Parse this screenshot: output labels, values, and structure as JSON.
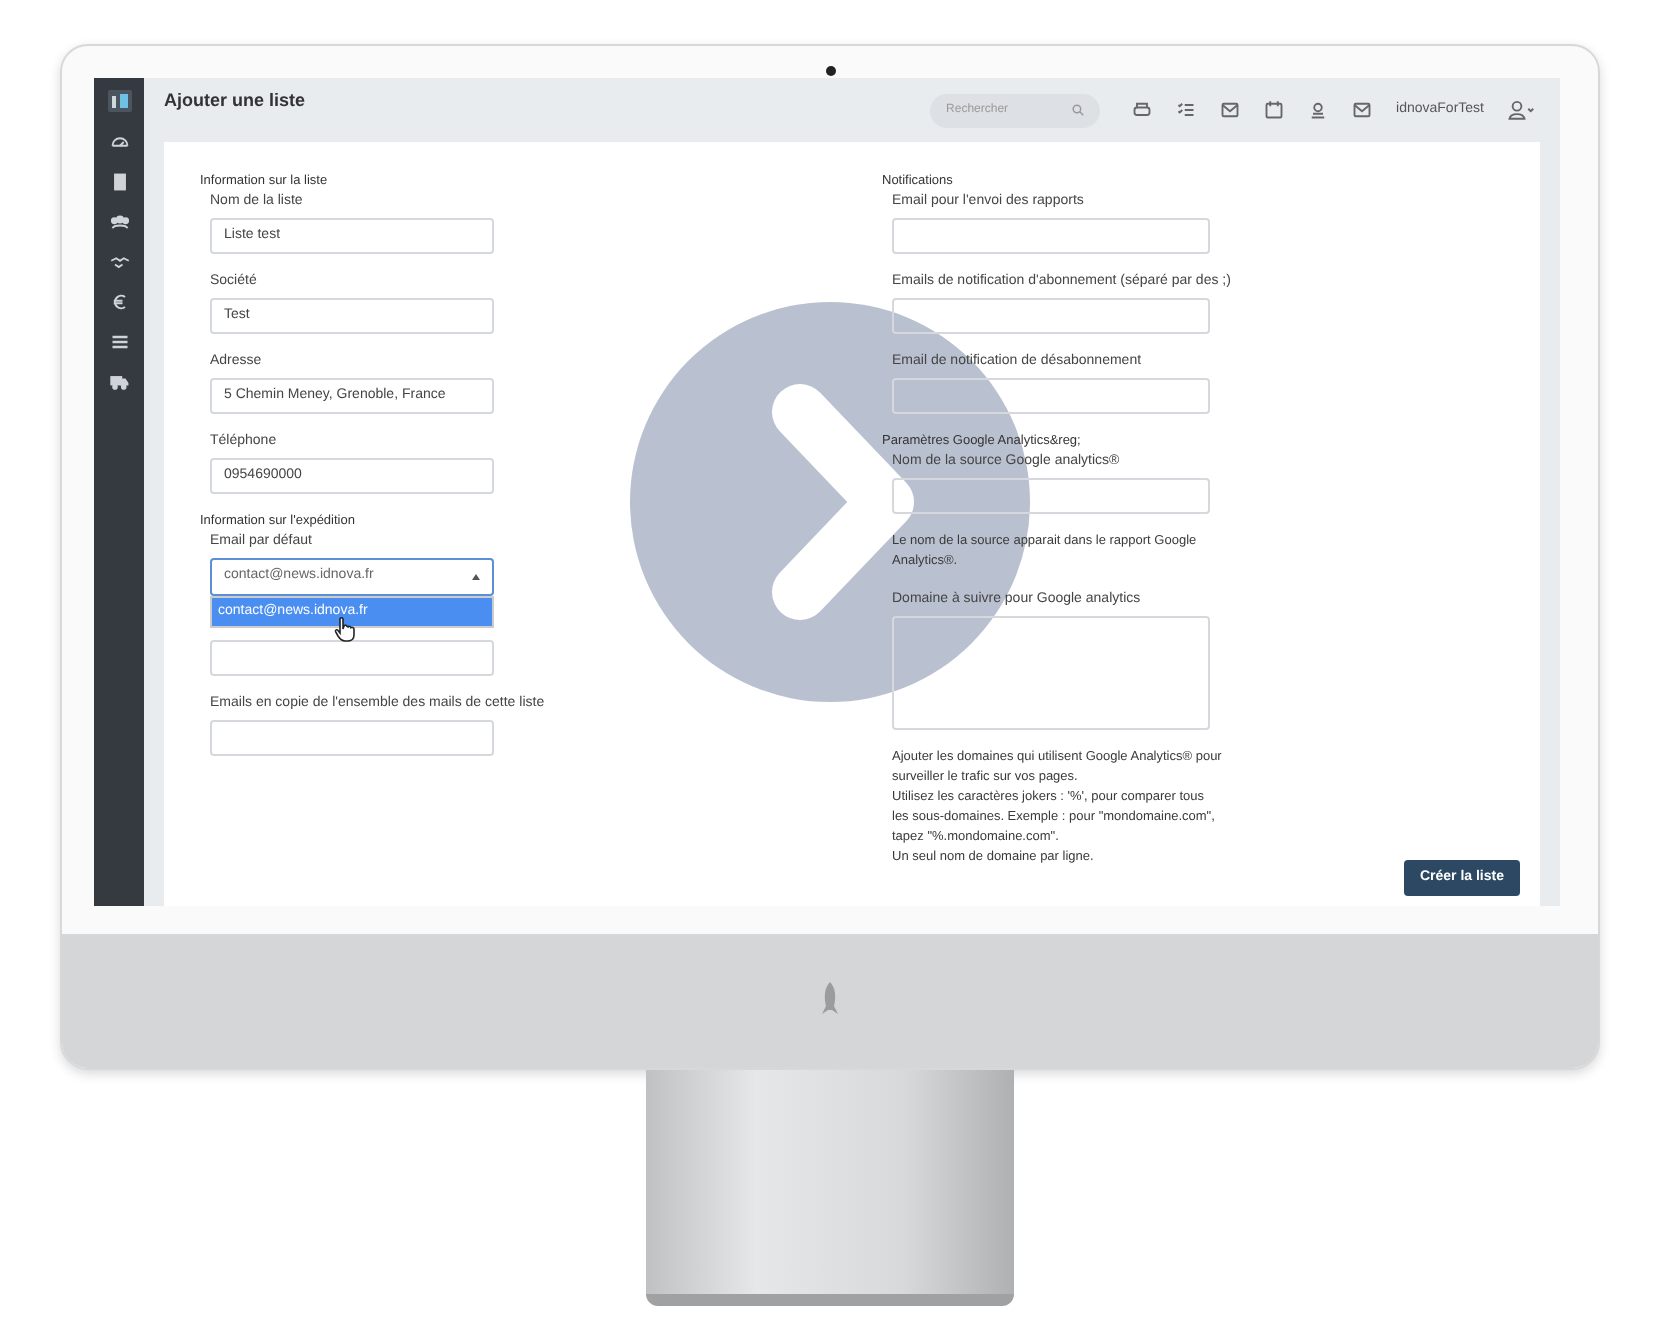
{
  "topbar": {
    "title": "Ajouter une liste",
    "search": {
      "placeholder": "Rechercher"
    },
    "username": "idnovaForTest"
  },
  "columns": [
    {
      "sections": [
        {
          "title": "Information sur la liste",
          "fields": [
            {
              "kind": "input",
              "label": "Nom de la liste",
              "value": "Liste test"
            },
            {
              "kind": "input",
              "label": "Société",
              "value": "Test"
            },
            {
              "kind": "input",
              "label": "Adresse",
              "value": "5 Chemin Meney, Grenoble, France"
            },
            {
              "kind": "input",
              "label": "Téléphone",
              "value": "0954690000"
            }
          ]
        },
        {
          "title": "Information sur l'expédition",
          "fields": [
            {
              "kind": "select",
              "label": "Email par défaut",
              "value": "contact@news.idnova.fr",
              "open": true,
              "options": [
                {
                  "label": "contact@news.idnova.fr",
                  "selected": true
                }
              ]
            },
            {
              "kind": "input"
            },
            {
              "kind": "input",
              "label": "Emails en copie de l'ensemble des mails de cette liste"
            }
          ]
        }
      ]
    },
    {
      "sections": [
        {
          "title": "Notifications",
          "fields": [
            {
              "kind": "input",
              "label": "Email pour l'envoi des rapports"
            },
            {
              "kind": "input",
              "label": "Emails de notification d'abonnement (séparé par des ;)"
            },
            {
              "kind": "input",
              "label": "Email de notification de désabonnement"
            }
          ]
        },
        {
          "title": "Paramètres Google Analytics&reg;",
          "fields": [
            {
              "kind": "input",
              "label": "Nom de la source Google analytics®"
            },
            {
              "kind": "help",
              "lines": [
                "Le nom de la source apparait dans le rapport Google Analytics®."
              ]
            },
            {
              "kind": "textarea",
              "label": "Domaine à suivre pour Google analytics"
            },
            {
              "kind": "help",
              "lines": [
                "Ajouter les domaines qui utilisent Google Analytics® pour surveiller le trafic sur vos pages.",
                "Utilisez les caractères jokers : '%', pour comparer tous les sous-domaines. Exemple : pour \"mondomaine.com\", tapez \"%.mondomaine.com\".",
                "Un seul nom de domaine par ligne."
              ]
            }
          ]
        }
      ]
    }
  ],
  "submit_button": "Créer la liste"
}
